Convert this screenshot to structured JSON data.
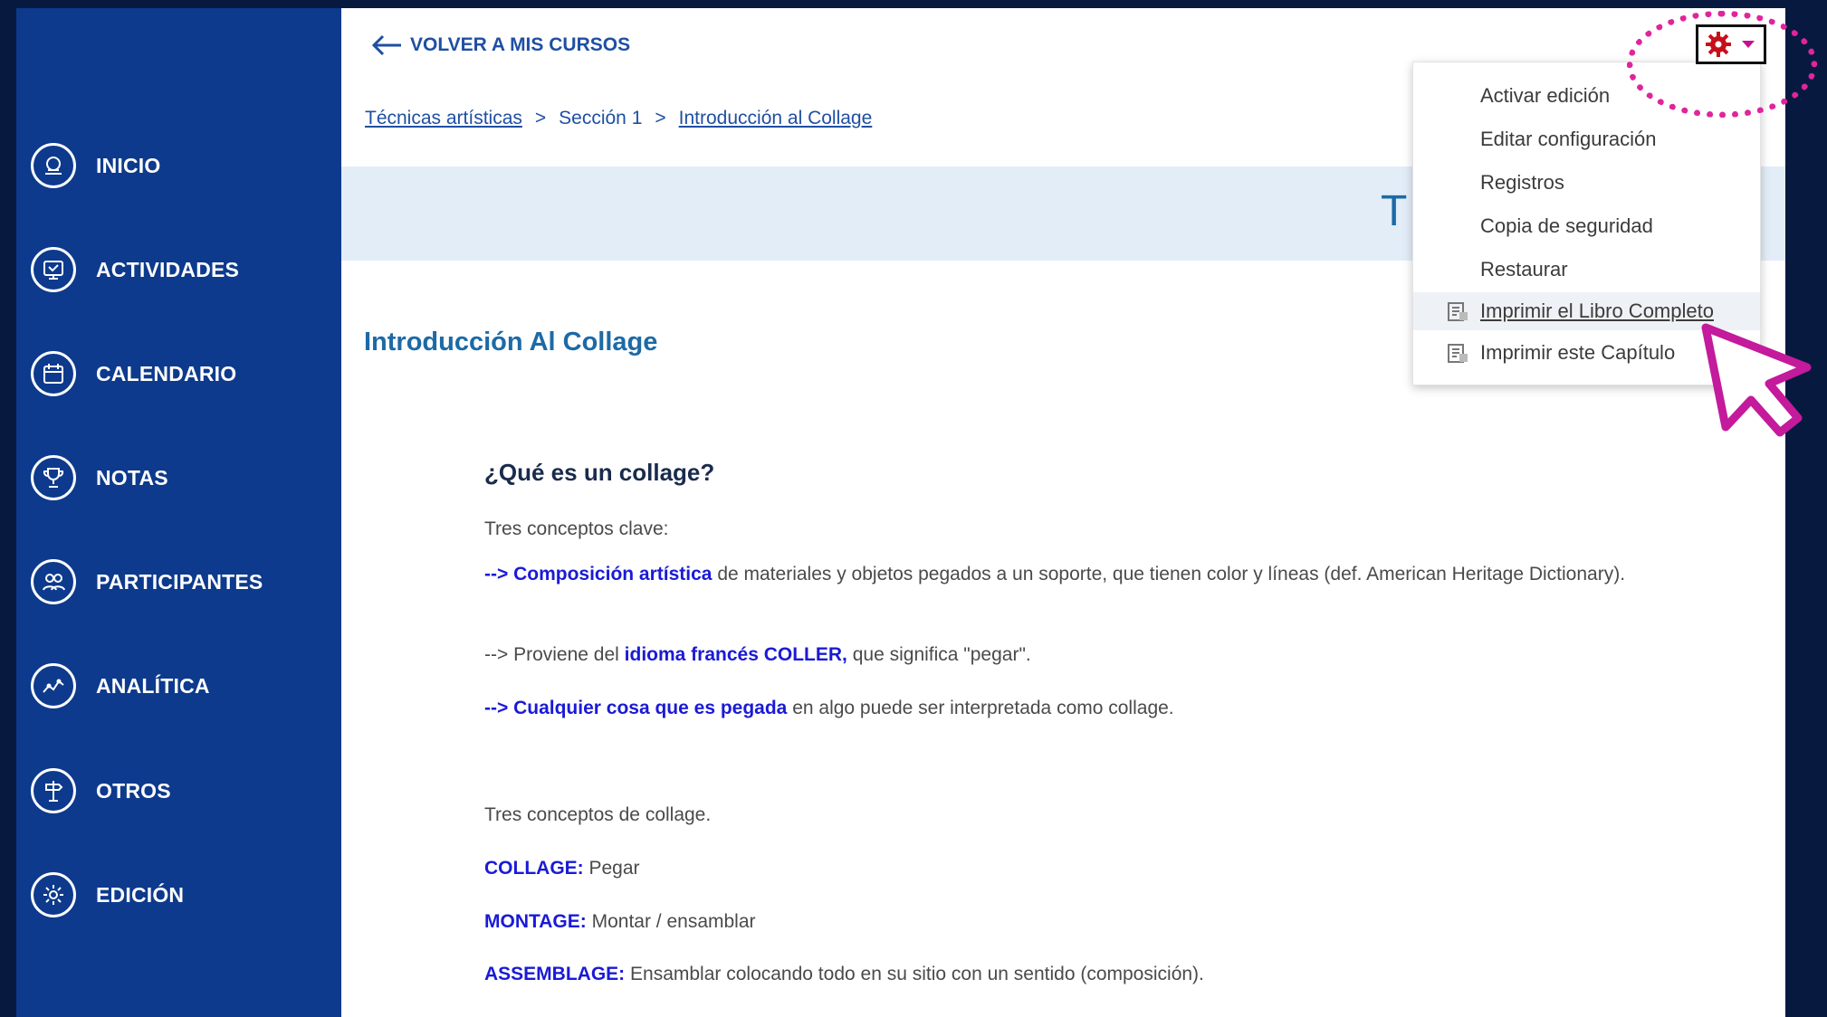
{
  "sidebar": {
    "items": [
      {
        "label": "INICIO",
        "icon": "home-icon"
      },
      {
        "label": "ACTIVIDADES",
        "icon": "activities-icon"
      },
      {
        "label": "CALENDARIO",
        "icon": "calendar-icon"
      },
      {
        "label": "NOTAS",
        "icon": "trophy-icon"
      },
      {
        "label": "PARTICIPANTES",
        "icon": "participants-icon"
      },
      {
        "label": "ANALÍTICA",
        "icon": "analytics-icon"
      },
      {
        "label": "OTROS",
        "icon": "signpost-icon"
      },
      {
        "label": "EDICIÓN",
        "icon": "gear-icon"
      }
    ]
  },
  "header": {
    "back_label": "VOLVER A MIS CURSOS",
    "breadcrumb": {
      "course": "Técnicas artísticas",
      "section": "Sección 1",
      "current": "Introducción al Collage",
      "separator": ">"
    },
    "banner_title": "TI"
  },
  "main": {
    "heading": "Introducción Al Collage",
    "question": "¿Qué es un collage?",
    "intro": "Tres conceptos clave:",
    "p1_arrow": "-->",
    "p1_strong": "Composición artística",
    "p1_rest": " de materiales y objetos pegados a un soporte, que tienen color y líneas  (def. American Heritage Dictionary).",
    "p2_pre": "--> Proviene del ",
    "p2_strong": "idioma francés COLLER,",
    "p2_rest": " que significa \"pegar\".",
    "p3_strong": "--> Cualquier cosa que es pegada",
    "p3_rest": " en algo puede ser interpretada como collage.",
    "concepts_title": "Tres conceptos de collage.",
    "c1_term": "COLLAGE:",
    "c1_def": " Pegar",
    "c2_term": "MONTAGE:",
    "c2_def": " Montar / ensamblar",
    "c3_term": "ASSEMBLAGE:",
    "c3_def": " Ensamblar colocando todo en su sitio con un sentido (composición)."
  },
  "menu": {
    "items": [
      {
        "label": "Activar edición"
      },
      {
        "label": "Editar configuración"
      },
      {
        "label": "Registros"
      },
      {
        "label": "Copia de seguridad"
      },
      {
        "label": "Restaurar"
      },
      {
        "label": "Imprimir el Libro Completo",
        "icon": "print-book-icon",
        "highlighted": true
      },
      {
        "label": "Imprimir este Capítulo",
        "icon": "print-chapter-icon"
      }
    ]
  },
  "colors": {
    "sidebar": "#0d3a8c",
    "accent": "#1c6aa6",
    "highlight_annotation": "#e0249c",
    "gear": "#c70f1a"
  }
}
